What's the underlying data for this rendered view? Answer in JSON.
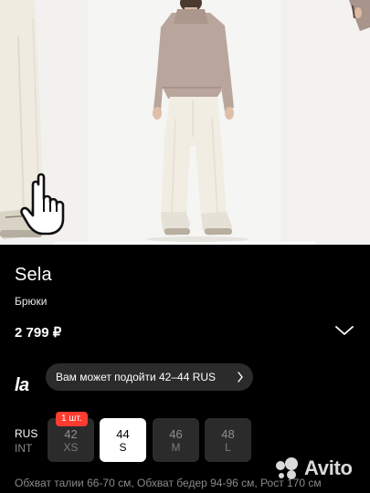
{
  "gallery": {
    "images": [
      {
        "name": "model-photo-1",
        "description": "white trousers close-up"
      },
      {
        "name": "model-photo-2",
        "description": "model in beige sweater and white trousers"
      },
      {
        "name": "model-photo-3",
        "description": "partial model photo"
      }
    ]
  },
  "product": {
    "brand": "Sela",
    "category": "Брюки",
    "price": "2 799 ₽"
  },
  "fit": {
    "logo": "la",
    "suggestion": "Вам может подойти 42–44 RUS"
  },
  "sizes": {
    "system_active": "RUS",
    "system_inactive": "INT",
    "badge": "1 шт.",
    "options": [
      {
        "rus": "42",
        "int": "XS",
        "selected": false
      },
      {
        "rus": "44",
        "int": "S",
        "selected": true
      },
      {
        "rus": "46",
        "int": "M",
        "selected": false
      },
      {
        "rus": "48",
        "int": "L",
        "selected": false
      }
    ]
  },
  "measurements": "Обхват талии 66-70 см, Обхват бедер 94-96 см, Рост 170 см",
  "watermark": "Avito",
  "colors": {
    "background": "#000000",
    "chip": "#2b2b2b",
    "badge": "#ff3b30",
    "sweater": "#b9a59c",
    "trousers": "#f1ede3"
  }
}
